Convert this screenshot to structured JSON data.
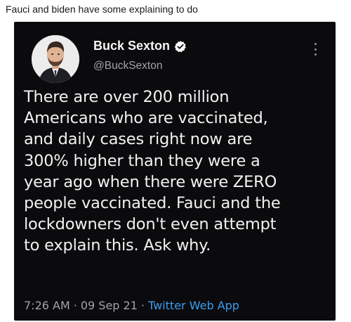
{
  "post": {
    "title": "Fauci and biden have some explaining to do"
  },
  "tweet": {
    "display_name": "Buck Sexton",
    "handle": "@BuckSexton",
    "verified": true,
    "text_lines": [
      "There are over 200 million",
      "Americans who are vaccinated,",
      "and daily cases right now are",
      "300% higher than they were a",
      "year ago when there were ZERO",
      "people vaccinated. Fauci and the",
      "lockdowners don't even attempt",
      "to explain this. Ask why."
    ],
    "time": "7:26 AM",
    "separator": "·",
    "date": "09 Sep 21",
    "source": "Twitter Web App"
  },
  "icons": {
    "verified": "verified-badge-icon",
    "more": "more-options-icon",
    "avatar": "profile-photo"
  },
  "colors": {
    "tweet_background": "#0b0b0d",
    "verified_badge": "#ffffff",
    "source_link": "#3a9ff0",
    "secondary_text": "#9fa3a8"
  }
}
